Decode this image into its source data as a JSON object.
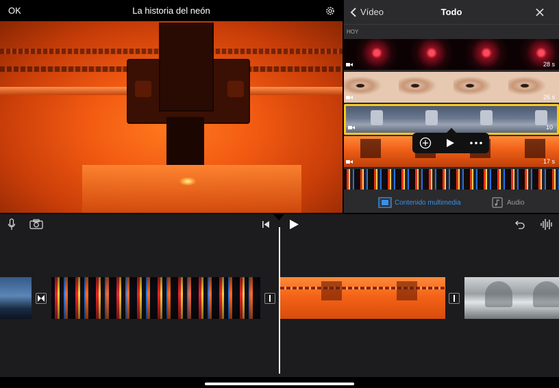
{
  "header": {
    "ok_label": "OK",
    "project_title": "La historia del neón"
  },
  "browser": {
    "back_label": "Vídeo",
    "title": "Todo",
    "section_label": "HOY",
    "clips": [
      {
        "duration": "28 s",
        "subject": "red laser"
      },
      {
        "duration": "26 s",
        "subject": "eyes"
      },
      {
        "duration": "10",
        "subject": "machinery",
        "selected": true
      },
      {
        "duration": "17 s",
        "subject": "orange workshop"
      },
      {
        "duration": "",
        "subject": "neon street"
      }
    ],
    "popover": {
      "add_icon": "plus-circle-icon",
      "play_icon": "play-icon",
      "more_icon": "ellipsis-icon"
    },
    "tabs": {
      "media_label": "Contenido multimedia",
      "audio_label": "Audio"
    }
  },
  "timeline": {
    "clips": [
      "harbor",
      "tokyo street",
      "neon workshop",
      "metal machinery"
    ],
    "transitions": [
      "cross-dissolve",
      "none",
      "none"
    ]
  },
  "colors": {
    "accent": "#3b8fe8",
    "selection": "#f6c91a",
    "panel": "#2b2b2d",
    "timeline_bg": "#1c1c1e"
  }
}
